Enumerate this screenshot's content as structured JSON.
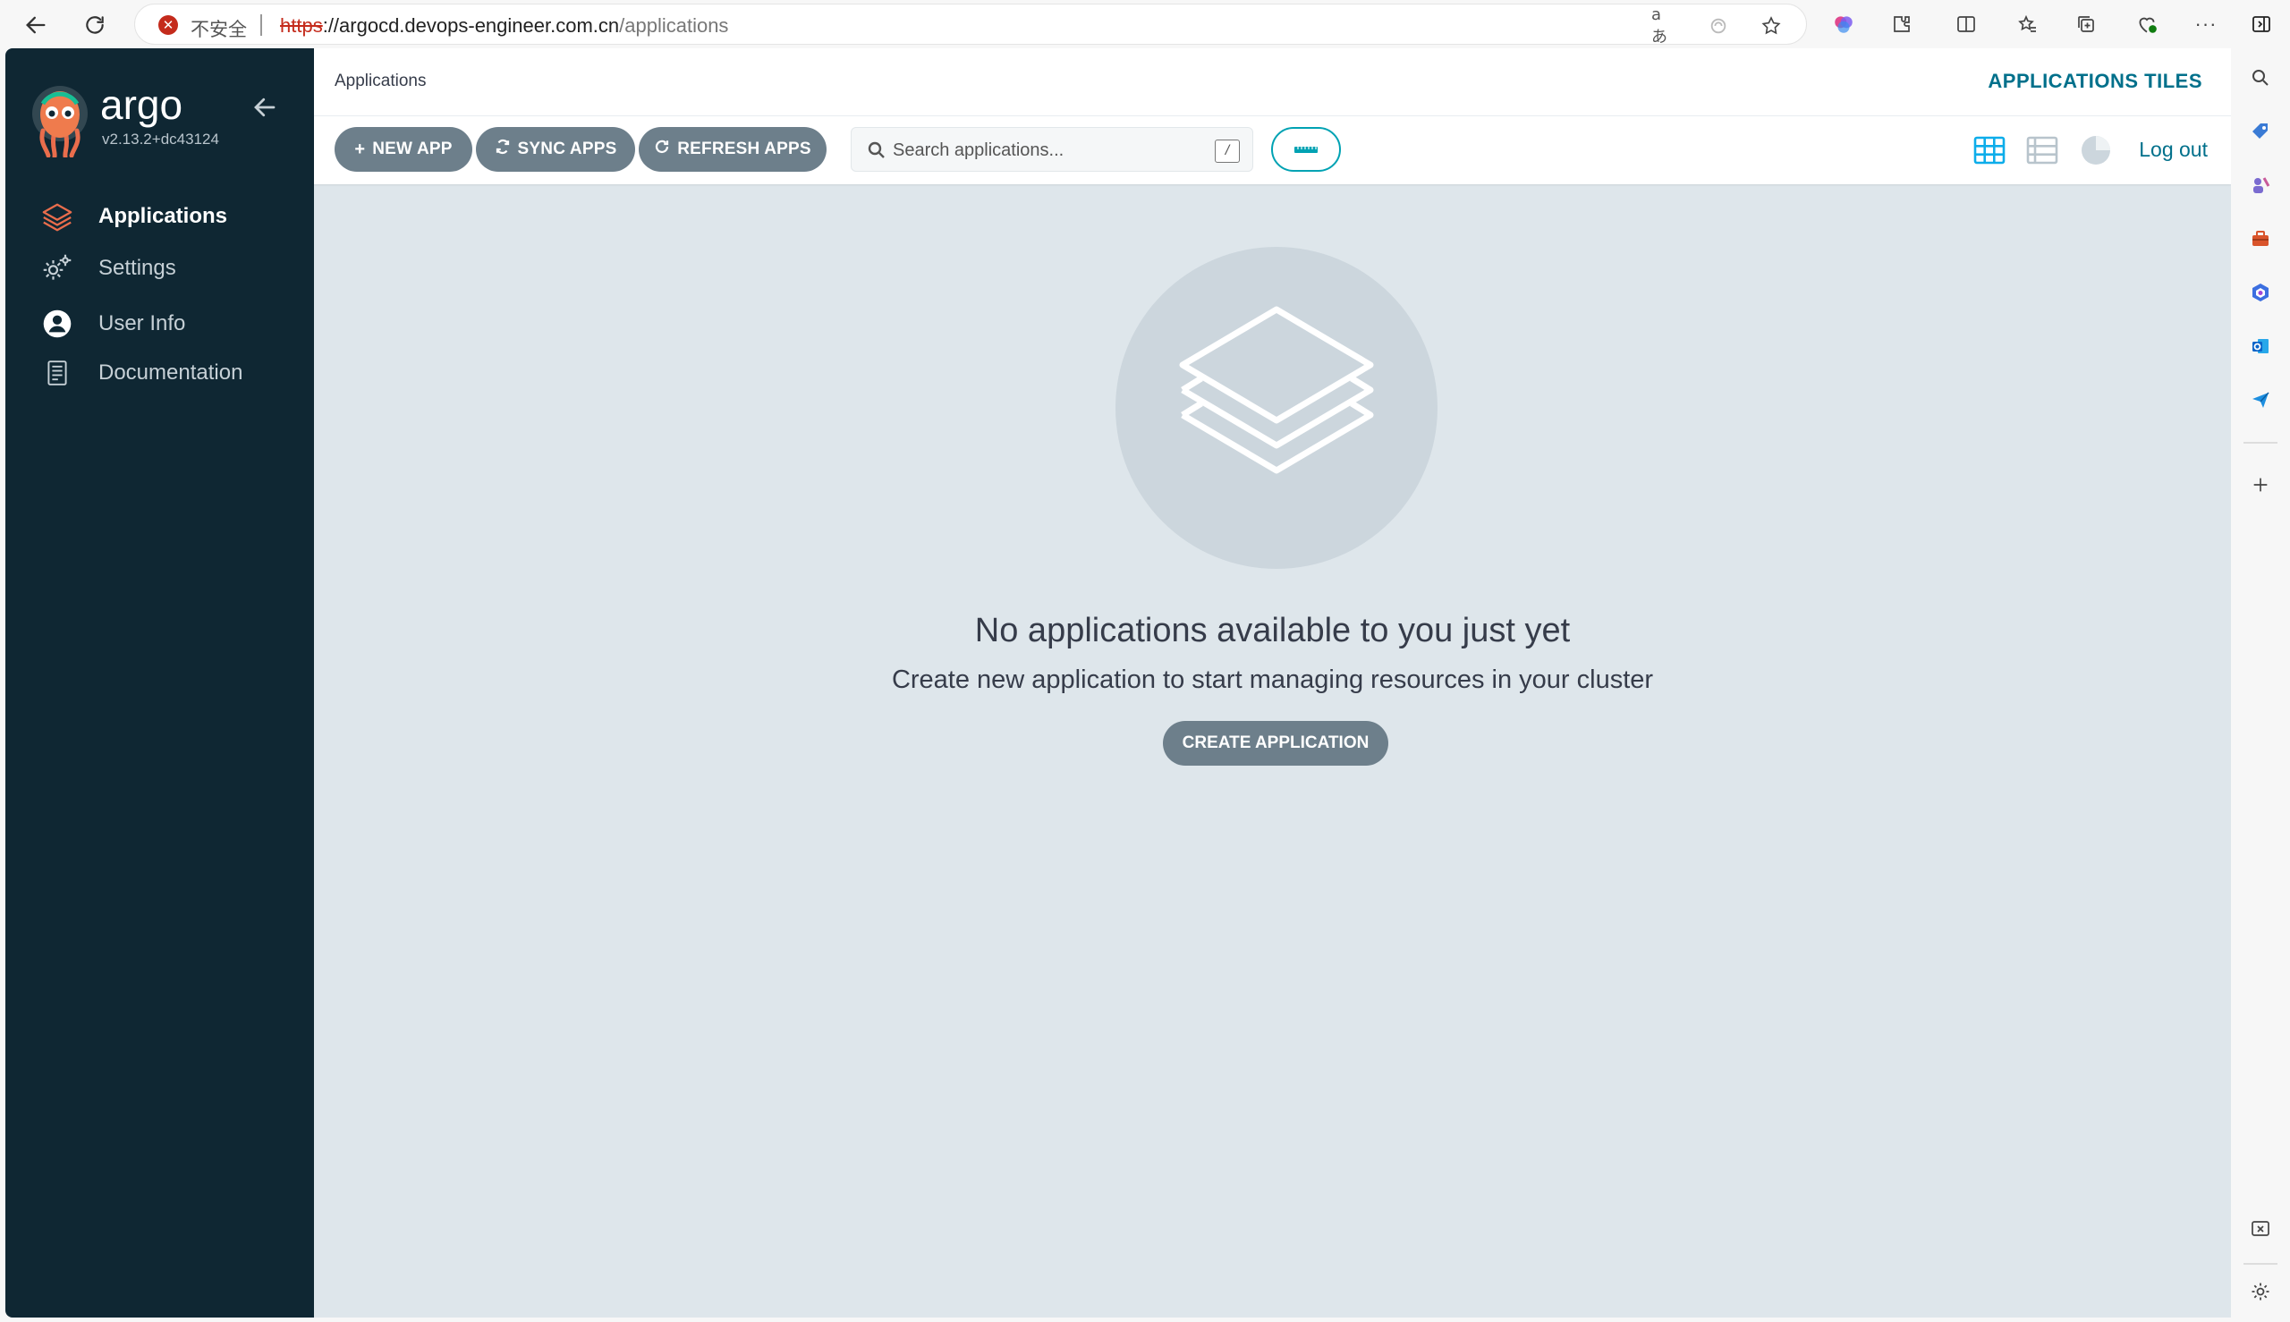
{
  "browser": {
    "security_label": "不安全",
    "url_scheme": "https",
    "url_rest_host": "://argocd.devops-engineer.com.cn",
    "url_path": "/applications"
  },
  "sidebar": {
    "logo_text": "argo",
    "version": "v2.13.2+dc43124",
    "items": [
      {
        "label": "Applications",
        "icon": "layers-icon",
        "active": true
      },
      {
        "label": "Settings",
        "icon": "gears-icon",
        "active": false
      },
      {
        "label": "User Info",
        "icon": "user-circle-icon",
        "active": false
      },
      {
        "label": "Documentation",
        "icon": "book-icon",
        "active": false
      }
    ]
  },
  "header": {
    "breadcrumb": "Applications",
    "view_title": "APPLICATIONS TILES"
  },
  "toolbar": {
    "new_app": "NEW APP",
    "sync_apps": "SYNC APPS",
    "refresh_apps": "REFRESH APPS",
    "search_placeholder": "Search applications...",
    "search_shortcut": "/",
    "logout": "Log out"
  },
  "empty_state": {
    "title": "No applications available to you just yet",
    "subtitle": "Create new application to start managing resources in your cluster",
    "create_button": "CREATE APPLICATION"
  },
  "colors": {
    "sidebar_bg": "#0f2733",
    "content_bg": "#dee6eb",
    "button_gray": "#6d7f8b",
    "accent_teal": "#00708b",
    "filter_border": "#00a2b3"
  }
}
